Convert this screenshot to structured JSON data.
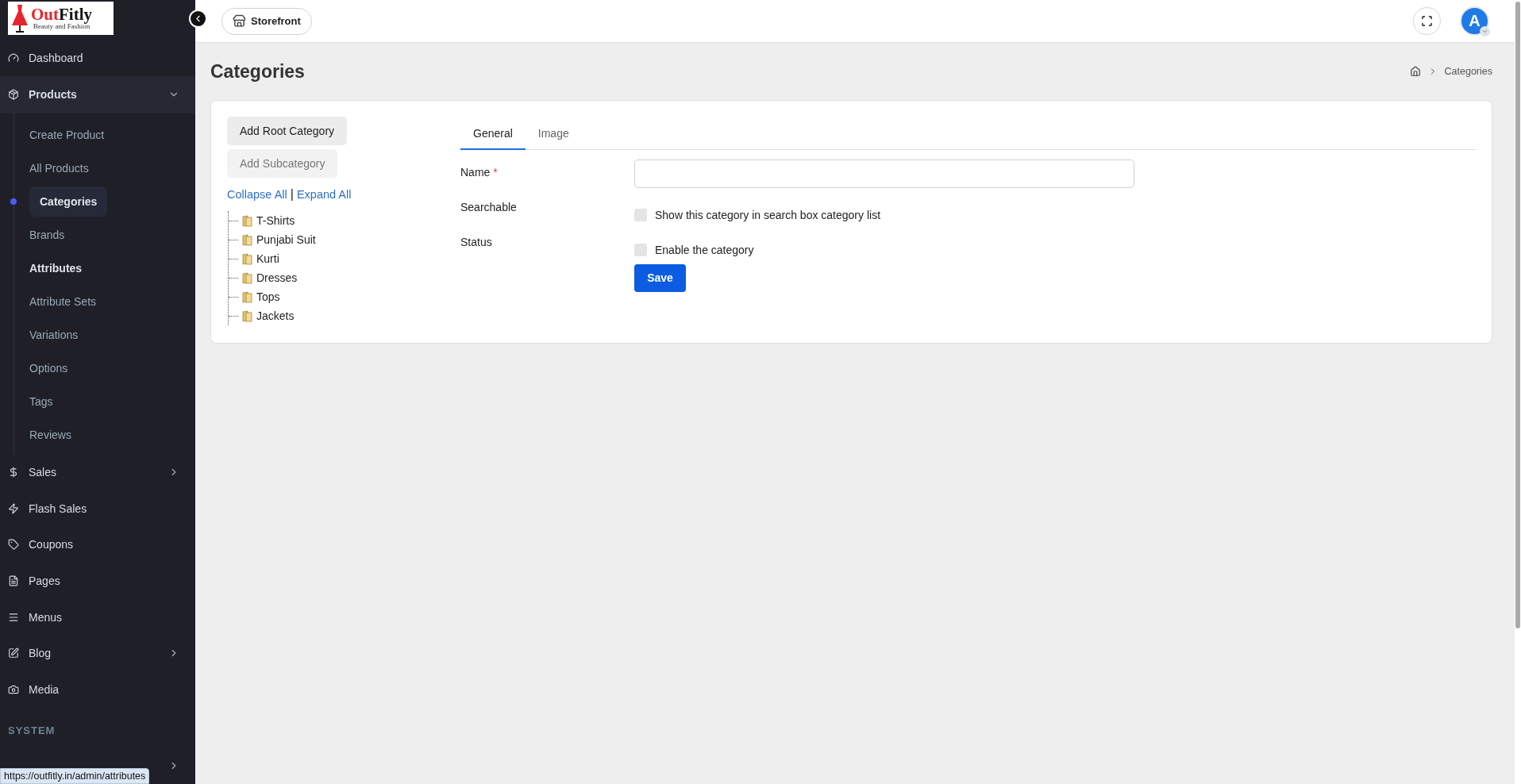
{
  "logo": {
    "parts": [
      {
        "text": "Out",
        "color": "#e5262d"
      },
      {
        "text": "Fitly",
        "color": "#111111"
      }
    ],
    "tagline": "Beauty and Fashion"
  },
  "sidebar": {
    "items": [
      {
        "label": "Dashboard",
        "expanded": false,
        "has_submenu": false
      },
      {
        "label": "Products",
        "expanded": true,
        "has_submenu": true,
        "children": [
          {
            "label": "Create Product",
            "selected": false,
            "emphasized": false
          },
          {
            "label": "All Products",
            "selected": false,
            "emphasized": false
          },
          {
            "label": "Categories",
            "selected": true,
            "emphasized": false
          },
          {
            "label": "Brands",
            "selected": false,
            "emphasized": false
          },
          {
            "label": "Attributes",
            "selected": false,
            "emphasized": true
          },
          {
            "label": "Attribute Sets",
            "selected": false,
            "emphasized": false
          },
          {
            "label": "Variations",
            "selected": false,
            "emphasized": false
          },
          {
            "label": "Options",
            "selected": false,
            "emphasized": false
          },
          {
            "label": "Tags",
            "selected": false,
            "emphasized": false
          },
          {
            "label": "Reviews",
            "selected": false,
            "emphasized": false
          }
        ]
      },
      {
        "label": "Sales",
        "expanded": false,
        "has_submenu": true
      },
      {
        "label": "Flash Sales",
        "expanded": false,
        "has_submenu": false
      },
      {
        "label": "Coupons",
        "expanded": false,
        "has_submenu": false
      },
      {
        "label": "Pages",
        "expanded": false,
        "has_submenu": false
      },
      {
        "label": "Menus",
        "expanded": false,
        "has_submenu": false
      },
      {
        "label": "Blog",
        "expanded": false,
        "has_submenu": true
      },
      {
        "label": "Media",
        "expanded": false,
        "has_submenu": false
      }
    ],
    "section_heading": "SYSTEM"
  },
  "status_url": "https://outfitly.in/admin/attributes",
  "topbar": {
    "storefront_button": "Storefront",
    "avatar_letter": "A"
  },
  "page": {
    "title": "Categories",
    "breadcrumb": [
      "Categories"
    ]
  },
  "tree_panel": {
    "buttons": [
      {
        "label": "Add Root Category",
        "disabled": false
      },
      {
        "label": "Add Subcategory",
        "disabled": true
      }
    ],
    "collapse_all": "Collapse All",
    "separator": "|",
    "expand_all": "Expand All",
    "categories": [
      "T-Shirts",
      "Punjabi Suit",
      "Kurti",
      "Dresses",
      "Tops",
      "Jackets"
    ]
  },
  "form": {
    "tabs": [
      {
        "label": "General",
        "selected": true
      },
      {
        "label": "Image",
        "selected": false
      }
    ],
    "fields": [
      {
        "kind": "text",
        "label": "Name",
        "required_mark": "*"
      },
      {
        "kind": "checkbox",
        "label": "Searchable",
        "option": "Show this category in search box category list",
        "checked": false
      },
      {
        "kind": "checkbox",
        "label": "Status",
        "option": "Enable the category",
        "checked": false
      }
    ],
    "save_button": "Save"
  }
}
